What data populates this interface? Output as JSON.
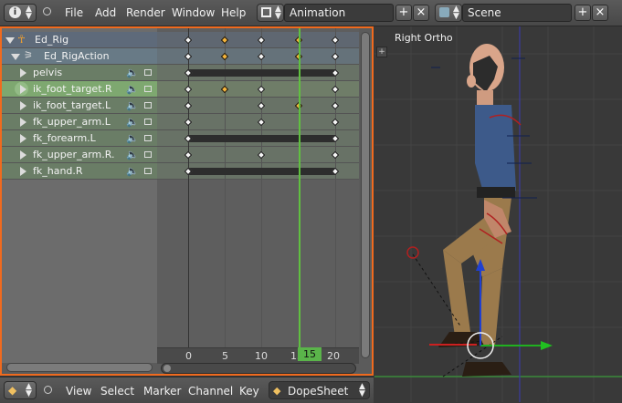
{
  "topbar": {
    "menu": [
      "File",
      "Add",
      "Render",
      "Window",
      "Help"
    ],
    "screen_layout": "Animation",
    "scene": "Scene"
  },
  "channels": [
    {
      "label": "Ed_Rig",
      "kind": "object"
    },
    {
      "label": "Ed_RigAction",
      "kind": "action"
    },
    {
      "label": "pelvis",
      "kind": "group"
    },
    {
      "label": "ik_foot_target.R",
      "kind": "group"
    },
    {
      "label": "ik_foot_target.L",
      "kind": "group"
    },
    {
      "label": "fk_upper_arm.L",
      "kind": "group"
    },
    {
      "label": "fk_forearm.L",
      "kind": "group"
    },
    {
      "label": "fk_upper_arm.R.",
      "kind": "group"
    },
    {
      "label": "fk_hand.R",
      "kind": "group"
    }
  ],
  "timeline": {
    "ticks": [
      "0",
      "5",
      "10",
      "15",
      "20"
    ],
    "current_frame": "15"
  },
  "viewport": {
    "label": "Right Ortho"
  },
  "bottombar": {
    "menu": [
      "View",
      "Select",
      "Marker",
      "Channel",
      "Key"
    ],
    "editor_mode": "DopeSheet"
  },
  "colors": {
    "accent": "#f06a1e",
    "current_frame": "#60c040",
    "keyframe_selected": "#f4b33b"
  }
}
